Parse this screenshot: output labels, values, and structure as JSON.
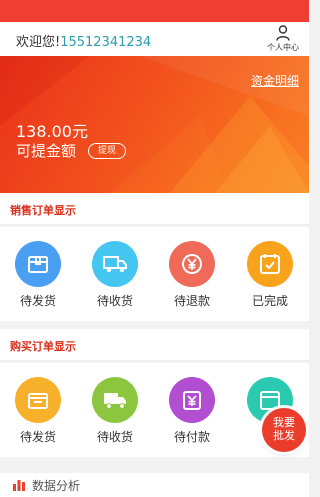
{
  "header": {
    "welcome_text": "欢迎您!",
    "phone": "15512341234",
    "user_center_label": "个人中心"
  },
  "banner": {
    "fund_detail_link": "资金明细",
    "amount": "138.00元",
    "withdrawable_label": "可提金额",
    "withdraw_button": "提现"
  },
  "sales_orders": {
    "title": "销售订单显示",
    "items": [
      {
        "label": "待发货",
        "icon": "box-icon",
        "color": "#4a9ff2"
      },
      {
        "label": "待收货",
        "icon": "truck-icon",
        "color": "#45c6f0"
      },
      {
        "label": "待退款",
        "icon": "yen-refund-icon",
        "color": "#f06a5a"
      },
      {
        "label": "已完成",
        "icon": "check-calendar-icon",
        "color": "#f9a31c"
      }
    ]
  },
  "purchase_orders": {
    "title": "购买订单显示",
    "items": [
      {
        "label": "待发货",
        "icon": "box-icon",
        "color": "#f7b02a"
      },
      {
        "label": "待收货",
        "icon": "truck-icon",
        "color": "#8cc63f"
      },
      {
        "label": "待付款",
        "icon": "yen-pay-icon",
        "color": "#b14fd0"
      },
      {
        "label": "已",
        "icon": "done-icon",
        "color": "#2cc9b1"
      }
    ]
  },
  "data_analysis": {
    "label": "数据分析",
    "icon": "bar-chart-icon"
  },
  "float_button": {
    "line1": "我要",
    "line2": "批发"
  },
  "colors": {
    "accent": "#ef3f33",
    "section_title": "#d8301e",
    "phone": "#2a9da8"
  }
}
